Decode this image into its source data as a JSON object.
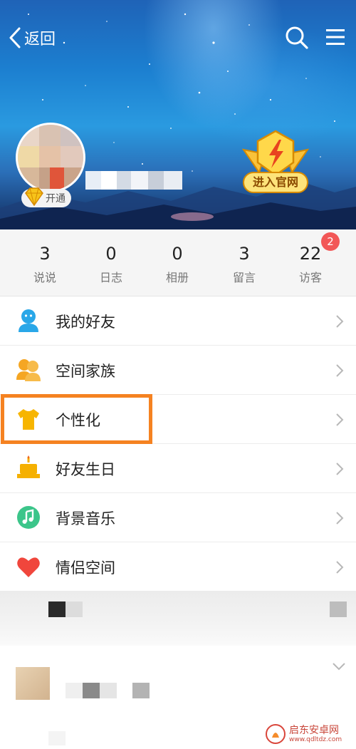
{
  "header": {
    "back_label": "返回",
    "back_icon": "chevron-left-icon",
    "search_icon": "search-icon",
    "menu_icon": "hamburger-menu-icon",
    "vip_badge_label": "开通",
    "official_site_label": "进入官网"
  },
  "stats": [
    {
      "value": "3",
      "label": "说说"
    },
    {
      "value": "0",
      "label": "日志"
    },
    {
      "value": "0",
      "label": "相册"
    },
    {
      "value": "3",
      "label": "留言"
    },
    {
      "value": "22",
      "label": "访客"
    }
  ],
  "visitor_badge": "2",
  "menu": [
    {
      "label": "我的好友",
      "icon": "friend-icon",
      "color": "#29a7e8"
    },
    {
      "label": "空间家族",
      "icon": "family-icon",
      "color": "#f5a623"
    },
    {
      "label": "个性化",
      "icon": "tshirt-icon",
      "color": "#f7b500"
    },
    {
      "label": "好友生日",
      "icon": "birthday-cake-icon",
      "color": "#f5b000"
    },
    {
      "label": "背景音乐",
      "icon": "music-note-icon",
      "color": "#3cc58a"
    },
    {
      "label": "情侣空间",
      "icon": "heart-icon",
      "color": "#f0463c"
    }
  ],
  "highlight_color": "#f58221",
  "watermark": {
    "text": "启东安卓网",
    "url": "www.qdltdz.com"
  }
}
